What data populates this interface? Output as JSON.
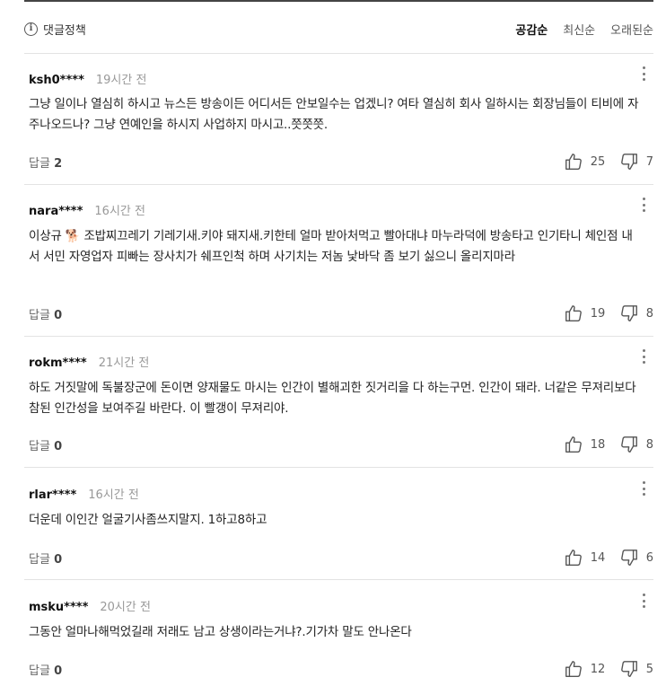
{
  "header": {
    "policy_label": "댓글정책",
    "sort_tabs": [
      "공감순",
      "최신순",
      "오래된순"
    ],
    "active_sort": "공감순"
  },
  "comments": [
    {
      "user": "ksh0****",
      "time": "19시간 전",
      "text": "그냥 일이나 열심히 하시고 뉴스든 방송이든 어디서든 안보일수는 업겠니? 여타 열심히 회사 일하시는 회장님들이 티비에 자주나오드나? 그냥 연예인을 하시지 사업하지 마시고..쯧쯧쯧.",
      "reply_label": "답글",
      "reply_count": "2",
      "likes": "25",
      "dislikes": "7"
    },
    {
      "user": "nara****",
      "time": "16시간 전",
      "text": "이상규 🐕 조밥찌끄레기 기레기새.키야 돼지새.키한테 얼마 받아처먹고 빨아대냐 마누라덕에 방송타고 인기타니 체인점 내서 서민 자영업자 피빠는 장사치가 쉐프인척 하며 사기치는 저놈 낯바닥 좀 보기 싫으니 올리지마라",
      "reply_label": "답글",
      "reply_count": "0",
      "likes": "19",
      "dislikes": "8"
    },
    {
      "user": "rokm****",
      "time": "21시간 전",
      "text": "하도 거짓말에 독불장군에 돈이면 양재물도 마시는 인간이 별해괴한 짓거리을 다 하는구먼. 인간이 돼라. 너같은 무져리보다 참된 인간성을 보여주길 바란다. 이 빨갱이 무져리야.",
      "reply_label": "답글",
      "reply_count": "0",
      "likes": "18",
      "dislikes": "8"
    },
    {
      "user": "rlar****",
      "time": "16시간 전",
      "text": "더운데 이인간 얼굴기사좀쓰지말지. 1하고8하고",
      "reply_label": "답글",
      "reply_count": "0",
      "likes": "14",
      "dislikes": "6"
    },
    {
      "user": "msku****",
      "time": "20시간 전",
      "text": "그동안 얼마나해먹었길래 저래도 남고 상생이라는거냐?.기가차 말도 안나온다",
      "reply_label": "답글",
      "reply_count": "0",
      "likes": "12",
      "dislikes": "5"
    }
  ],
  "icons": {
    "policy": "info-circle-icon",
    "more": "kebab-menu-icon",
    "like": "thumbs-up-icon",
    "dislike": "thumbs-down-icon"
  }
}
